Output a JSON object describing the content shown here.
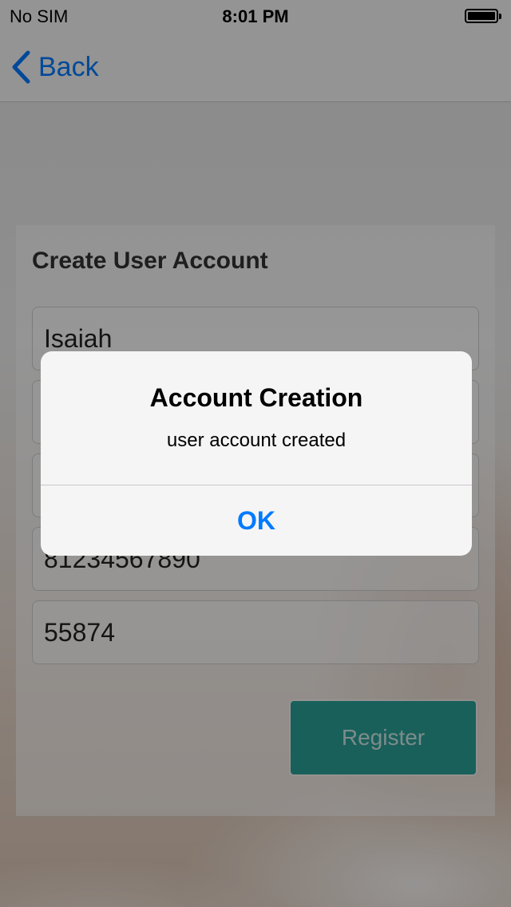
{
  "status_bar": {
    "carrier": "No SIM",
    "time": "8:01 PM"
  },
  "nav": {
    "back_label": "Back"
  },
  "form": {
    "title": "Create User Account",
    "fields": [
      {
        "value": "Isaiah"
      },
      {
        "value": ""
      },
      {
        "value": ""
      },
      {
        "value": "81234567890"
      },
      {
        "value": "55874"
      }
    ],
    "register_label": "Register"
  },
  "alert": {
    "title": "Account Creation",
    "message": "user account created",
    "ok_label": "OK"
  },
  "colors": {
    "accent": "#007aff",
    "register_button": "#2aa198"
  }
}
